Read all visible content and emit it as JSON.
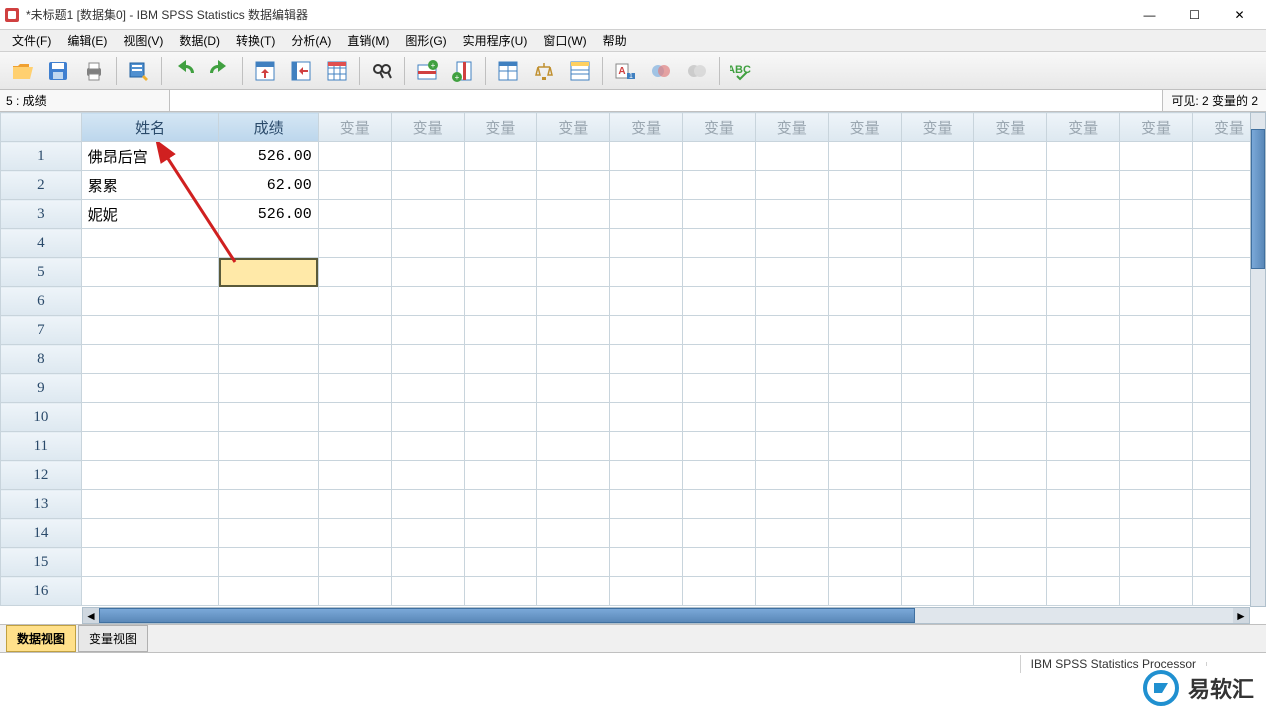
{
  "window": {
    "title": "*未标题1 [数据集0] - IBM SPSS Statistics 数据编辑器",
    "min": "—",
    "max": "☐",
    "close": "✕"
  },
  "menu": {
    "file": "文件(F)",
    "edit": "编辑(E)",
    "view": "视图(V)",
    "data": "数据(D)",
    "transform": "转换(T)",
    "analyze": "分析(A)",
    "direct": "直销(M)",
    "graphs": "图形(G)",
    "utilities": "实用程序(U)",
    "window": "窗口(W)",
    "help": "帮助"
  },
  "toolbar_icons": {
    "open": "folder-open",
    "save": "floppy",
    "print": "printer",
    "recall": "dialog-recall",
    "undo": "undo",
    "redo": "redo",
    "goto": "goto-case",
    "gotovar": "goto-var",
    "vars": "variables",
    "find": "binoculars",
    "insertcase": "insert-case",
    "insertvar": "insert-var",
    "split": "split-file",
    "weight": "weight-cases",
    "select": "select-cases",
    "valuelabels": "value-labels",
    "usesets": "use-sets",
    "showall": "show-all",
    "spell": "spellcheck"
  },
  "cellref": {
    "label": "5 : 成绩",
    "visible": "可见:  2 变量的 2"
  },
  "columns": {
    "name": "姓名",
    "score": "成绩",
    "vars": [
      "变量",
      "变量",
      "变量",
      "变量",
      "变量",
      "变量",
      "变量",
      "变量",
      "变量",
      "变量",
      "变量",
      "变量",
      "变量"
    ]
  },
  "rows": {
    "labels": [
      "1",
      "2",
      "3",
      "4",
      "5",
      "6",
      "7",
      "8",
      "9",
      "10",
      "11",
      "12",
      "13",
      "14",
      "15",
      "16"
    ],
    "data": [
      {
        "name": "佛昂后宫",
        "score": "526.00"
      },
      {
        "name": "累累",
        "score": "62.00"
      },
      {
        "name": "妮妮",
        "score": "526.00"
      }
    ],
    "selected_row": 5,
    "selected_col": "score"
  },
  "tabs": {
    "data": "数据视图",
    "var": "变量视图"
  },
  "status": {
    "processor": "IBM SPSS Statistics Processor"
  },
  "watermark": {
    "text": "易软汇"
  }
}
